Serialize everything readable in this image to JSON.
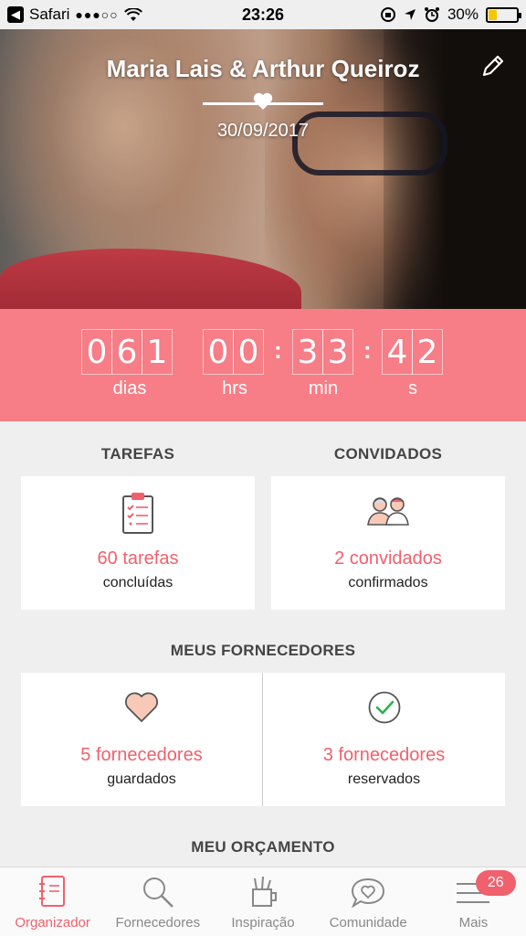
{
  "status_bar": {
    "back_app": "Safari",
    "signal": "●●●○○",
    "time": "23:26",
    "battery_percent": "30%",
    "battery_level": 0.3,
    "battery_color": "#f6c600"
  },
  "header": {
    "couple_names": "Maria Lais & Arthur Queiroz",
    "wedding_date": "30/09/2017",
    "edit_icon": "pencil-icon"
  },
  "countdown": {
    "days_digits": [
      "0",
      "6",
      "1"
    ],
    "hours_digits": [
      "0",
      "0"
    ],
    "minutes_digits": [
      "3",
      "3"
    ],
    "seconds_digits": [
      "4",
      "2"
    ],
    "labels": {
      "days": "dias",
      "hours": "hrs",
      "minutes": "min",
      "seconds": "s"
    },
    "accent": "#f77d86"
  },
  "tasks": {
    "title": "TAREFAS",
    "count_label": "60 tarefas",
    "status_label": "concluídas",
    "icon": "clipboard-icon"
  },
  "guests": {
    "title": "CONVIDADOS",
    "count_label": "2 convidados",
    "status_label": "confirmados",
    "icon": "guests-icon"
  },
  "suppliers": {
    "title": "MEUS FORNECEDORES",
    "saved_label": "5 fornecedores",
    "saved_status": "guardados",
    "booked_label": "3 fornecedores",
    "booked_status": "reservados"
  },
  "budget": {
    "title": "MEU ORÇAMENTO"
  },
  "tabbar": {
    "items": [
      {
        "label": "Organizador",
        "icon": "notebook-icon"
      },
      {
        "label": "Fornecedores",
        "icon": "search-icon"
      },
      {
        "label": "Inspiração",
        "icon": "inspiration-icon"
      },
      {
        "label": "Comunidade",
        "icon": "chat-heart-icon"
      },
      {
        "label": "Mais",
        "icon": "menu-icon"
      }
    ],
    "more_badge": "26"
  },
  "colors": {
    "brand": "#f0616d",
    "background": "#efefef"
  }
}
